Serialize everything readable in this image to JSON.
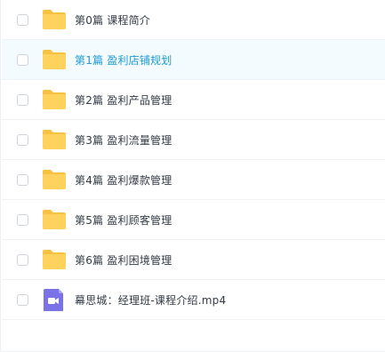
{
  "file_list": {
    "items": [
      {
        "name": "第0篇 课程简介",
        "type": "folder",
        "icon": "folder-icon",
        "selected": false
      },
      {
        "name": "第1篇 盈利店铺规划",
        "type": "folder",
        "icon": "folder-icon",
        "selected": true
      },
      {
        "name": "第2篇 盈利产品管理",
        "type": "folder",
        "icon": "folder-icon",
        "selected": false
      },
      {
        "name": "第3篇 盈利流量管理",
        "type": "folder",
        "icon": "folder-icon",
        "selected": false
      },
      {
        "name": "第4篇 盈利爆款管理",
        "type": "folder",
        "icon": "folder-icon",
        "selected": false
      },
      {
        "name": "第5篇 盈利顾客管理",
        "type": "folder",
        "icon": "folder-icon",
        "selected": false
      },
      {
        "name": "第6篇 盈利困境管理",
        "type": "folder",
        "icon": "folder-icon",
        "selected": false
      },
      {
        "name": "幕思城：经理班-课程介绍.mp4",
        "type": "video",
        "icon": "video-file-icon",
        "selected": false
      }
    ]
  },
  "colors": {
    "folder": "#ffd25d",
    "folder_tab": "#f7c244",
    "video": "#7a73e8",
    "selected_text": "#1d9bd6",
    "selected_bg": "#f4fbfe",
    "text": "#333b46"
  }
}
